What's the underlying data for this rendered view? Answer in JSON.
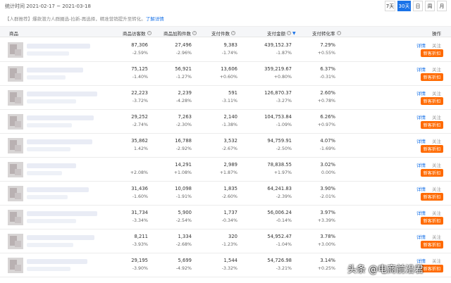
{
  "header": {
    "stat_time": "统计时间 2021-02-17 ~ 2021-03-18",
    "range_buttons": [
      {
        "label": "7天",
        "active": false
      },
      {
        "label": "30天",
        "active": true
      },
      {
        "label": "日",
        "active": false
      },
      {
        "label": "周",
        "active": false
      },
      {
        "label": "月",
        "active": false
      }
    ]
  },
  "notice": {
    "tag": "【人群推荐】",
    "text": "爆款潜力人群圈选-拉新-再选择，精准营销提升至转化。",
    "link": "了解详情"
  },
  "table": {
    "columns": [
      "商品",
      "商品访客数",
      "商品加购件数",
      "支付件数",
      "支付金额",
      "支付转化率",
      "操作"
    ],
    "rows": [
      {
        "visitors": "87,306",
        "visitors_chg": "-2.59%",
        "cart": "27,496",
        "cart_chg": "-2.96%",
        "paid_items": "9,383",
        "paid_items_chg": "-1.74%",
        "amount": "439,152.37",
        "amount_chg": "-1.87%",
        "conv": "7.29%",
        "conv_chg": "+0.55%"
      },
      {
        "visitors": "75,125",
        "visitors_chg": "-1.40%",
        "cart": "56,921",
        "cart_chg": "-1.27%",
        "paid_items": "13,606",
        "paid_items_chg": "+0.60%",
        "amount": "359,219.67",
        "amount_chg": "+0.80%",
        "conv": "6.37%",
        "conv_chg": "-0.31%"
      },
      {
        "visitors": "22,223",
        "visitors_chg": "-3.72%",
        "cart": "2,239",
        "cart_chg": "-4.28%",
        "paid_items": "591",
        "paid_items_chg": "-3.11%",
        "amount": "126,870.37",
        "amount_chg": "-3.27%",
        "conv": "2.60%",
        "conv_chg": "+0.78%"
      },
      {
        "visitors": "29,252",
        "visitors_chg": "-2.74%",
        "cart": "7,263",
        "cart_chg": "-2.30%",
        "paid_items": "2,140",
        "paid_items_chg": "-1.38%",
        "amount": "104,753.84",
        "amount_chg": "-1.09%",
        "conv": "6.26%",
        "conv_chg": "+0.97%"
      },
      {
        "visitors": "35,862",
        "visitors_chg": "1.42%",
        "cart": "16,788",
        "cart_chg": "-2.92%",
        "paid_items": "3,532",
        "paid_items_chg": "-2.67%",
        "amount": "94,759.91",
        "amount_chg": "-2.50%",
        "conv": "4.07%",
        "conv_chg": "-1.69%"
      },
      {
        "visitors": "",
        "visitors_chg": "+2.08%",
        "cart": "14,291",
        "cart_chg": "+1.08%",
        "paid_items": "2,989",
        "paid_items_chg": "+1.87%",
        "amount": "78,838.55",
        "amount_chg": "+1.97%",
        "conv": "3.02%",
        "conv_chg": "0.00%"
      },
      {
        "visitors": "31,436",
        "visitors_chg": "-1.60%",
        "cart": "10,098",
        "cart_chg": "-1.91%",
        "paid_items": "1,835",
        "paid_items_chg": "-2.60%",
        "amount": "64,241.83",
        "amount_chg": "-2.39%",
        "conv": "3.90%",
        "conv_chg": "-2.01%"
      },
      {
        "visitors": "31,734",
        "visitors_chg": "-3.34%",
        "cart": "5,900",
        "cart_chg": "-2.54%",
        "paid_items": "1,737",
        "paid_items_chg": "-0.34%",
        "amount": "56,006.24",
        "amount_chg": "-0.14%",
        "conv": "3.97%",
        "conv_chg": "+3.39%"
      },
      {
        "visitors": "8,211",
        "visitors_chg": "-3.93%",
        "cart": "1,334",
        "cart_chg": "-2.68%",
        "paid_items": "320",
        "paid_items_chg": "-1.23%",
        "amount": "54,952.47",
        "amount_chg": "-1.04%",
        "conv": "3.78%",
        "conv_chg": "+3.00%"
      },
      {
        "visitors": "29,195",
        "visitors_chg": "-3.90%",
        "cart": "5,699",
        "cart_chg": "-4.92%",
        "paid_items": "1,544",
        "paid_items_chg": "-3.32%",
        "amount": "54,726.98",
        "amount_chg": "-3.21%",
        "conv": "3.14%",
        "conv_chg": "+0.25%"
      }
    ],
    "actions": {
      "detail": "详情",
      "follow": "关注",
      "promo": "新客折扣"
    }
  },
  "watermark": "头条 @电商前沿君",
  "colors": {
    "accent": "#1a73e8",
    "promo": "#ff6a00"
  }
}
